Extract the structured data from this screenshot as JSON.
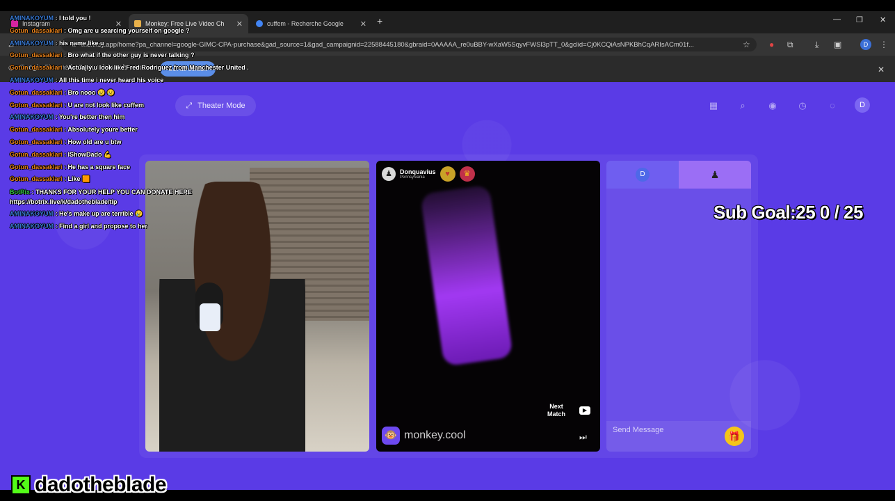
{
  "browser": {
    "tabs": [
      {
        "title": "Instagram",
        "active": false,
        "favicon_color": "#d6249f"
      },
      {
        "title": "Monkey: Free Live Video Ch",
        "active": true,
        "favicon_color": "#e8b04a"
      },
      {
        "title": "cuffem - Recherche Google",
        "active": false,
        "favicon_color": "#4285f4"
      }
    ],
    "new_tab": "+",
    "url": "monkey.app/home?pa_channel=google-GIMC-CPA-purchase&gad_source=1&gad_campaignid=22588445180&gbraid=0AAAAA_re0uBBY-wXaW5SqyvFWSl3pTT_0&gclid=Cj0KCQiAsNPKBhCqARIsACm01f...",
    "profile_initial": "D",
    "infobar_text": "Google Chrome isn't your default browser",
    "infobar_button": "Set as default"
  },
  "page": {
    "theater_mode_label": "Theater Mode",
    "header_avatar": "D",
    "remote_user": {
      "name": "Donquavius",
      "location": "Pennsylvania"
    },
    "next_match_label_1": "Next",
    "next_match_label_2": "Match",
    "watermark_text": "monkey.cool",
    "chat_tab_initial": "D",
    "send_message_placeholder": "Send Message"
  },
  "sub_goal": "Sub Goal:25  0 / 25",
  "stream_chat": [
    {
      "user": "AMINAKOYUM",
      "text": "I told you !",
      "cls": "aminakoyum"
    },
    {
      "user": "Gotun_dassaklari",
      "text": "Omg are u searcing yourself on google ?",
      "cls": ""
    },
    {
      "user": "AMINAKOYUM",
      "text": "his name like u",
      "cls": "aminakoyum"
    },
    {
      "user": "Gotun_dassaklari",
      "text": "Bro what if the other guy is never talking ?",
      "cls": ""
    },
    {
      "user": "Gotun_dassaklari",
      "text": "Actually u look like Fred Rodriguez from Manchester United .",
      "cls": ""
    },
    {
      "user": "AMINAKOYUM",
      "text": "All this time i never heard his voice",
      "cls": "aminakoyum"
    },
    {
      "user": "Gotun_dassaklari",
      "text": "Bro nooo 😢 😢",
      "cls": ""
    },
    {
      "user": "Gotun_dassaklari",
      "text": "U are not look like cuffem",
      "cls": ""
    },
    {
      "user": "AMINAKOYUM",
      "text": "You're better then him",
      "cls": "aminakoyum"
    },
    {
      "user": "Gotun_dassaklari",
      "text": "Absolutely youre better",
      "cls": ""
    },
    {
      "user": "Gotun_dassaklari",
      "text": "How old are u btw",
      "cls": ""
    },
    {
      "user": "Gotun_dassaklari",
      "text": "IShowDado 💪",
      "cls": ""
    },
    {
      "user": "Gotun_dassaklari",
      "text": "He has a square face",
      "cls": ""
    },
    {
      "user": "Gotun_dassaklari",
      "text": "Like 🟧",
      "cls": ""
    },
    {
      "user": "BotRix",
      "text": "THANKS FOR YOUR HELP YOU CAN DONATE HERE https://botrix.live/k/dadotheblade/tip",
      "cls": "botrix",
      "wrap": true
    },
    {
      "user": "AMINAKOYUM",
      "text": "He's make up are terrible 😢",
      "cls": "aminakoyum"
    },
    {
      "user": "AMINAKOYUM",
      "text": "Find a girl and propose to her",
      "cls": "aminakoyum"
    }
  ],
  "streamer_name": "dadotheblade",
  "kick_logo_letter": "K"
}
